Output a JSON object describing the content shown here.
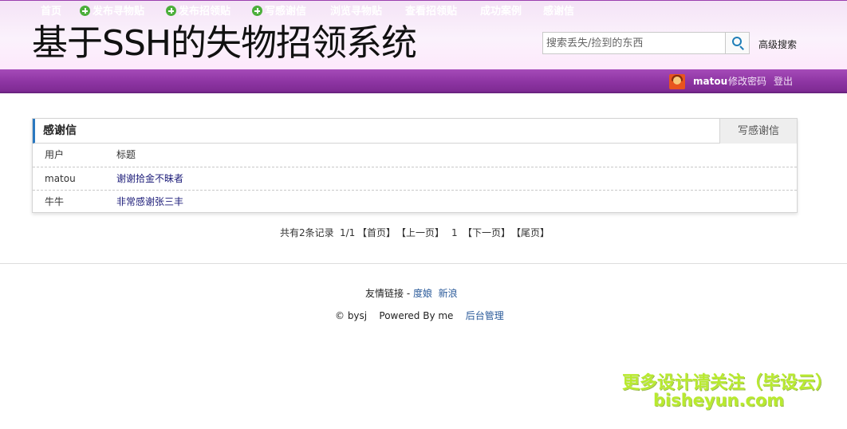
{
  "header": {
    "title_prefix": "基于",
    "title_latin": "SSH",
    "title_suffix": "的失物招领系统",
    "search_placeholder": "搜索丢失/捡到的东西",
    "advanced_search": "高级搜索"
  },
  "nav": {
    "items": [
      {
        "label": "首页",
        "icon": ""
      },
      {
        "label": "发布寻物贴",
        "icon": "plus-icon"
      },
      {
        "label": "发布招领贴",
        "icon": "plus-icon"
      },
      {
        "label": "写感谢信",
        "icon": "plus-icon"
      },
      {
        "label": "浏览寻物贴",
        "icon": ""
      },
      {
        "label": "查看招领贴",
        "icon": ""
      },
      {
        "label": "成功案例",
        "icon": ""
      },
      {
        "label": "感谢信",
        "icon": ""
      }
    ],
    "username": "matou",
    "change_password": "修改密码",
    "logout": "登出"
  },
  "panel": {
    "title": "感谢信",
    "write_button": "写感谢信",
    "columns": [
      "用户",
      "标题"
    ],
    "rows": [
      {
        "user": "matou",
        "title": "谢谢拾金不昧者"
      },
      {
        "user": "牛牛",
        "title": "非常感谢张三丰"
      }
    ]
  },
  "pagination": {
    "total": "共有2条记录",
    "page": "1/1",
    "first": "【首页】",
    "prev": "【上一页】",
    "current": "1",
    "next": "【下一页】",
    "last": "【尾页】"
  },
  "footer": {
    "links_label": "友情链接 - ",
    "links": [
      "度娘",
      "新浪"
    ],
    "copyright": "© bysj",
    "powered": "Powered By me",
    "admin": "后台管理"
  },
  "watermark": {
    "line1": "更多设计请关注（毕设云）",
    "line2": "bisheyun.com"
  },
  "colors": {
    "nav_purple": "#8e35a3",
    "header_pink": "#f4e3f6",
    "panel_accent": "#2a78c0",
    "link_blue": "#1b1b78",
    "pager_current": "#cc2222",
    "plus_green": "#4caf3b",
    "watermark_green": "#b8ea2e"
  }
}
